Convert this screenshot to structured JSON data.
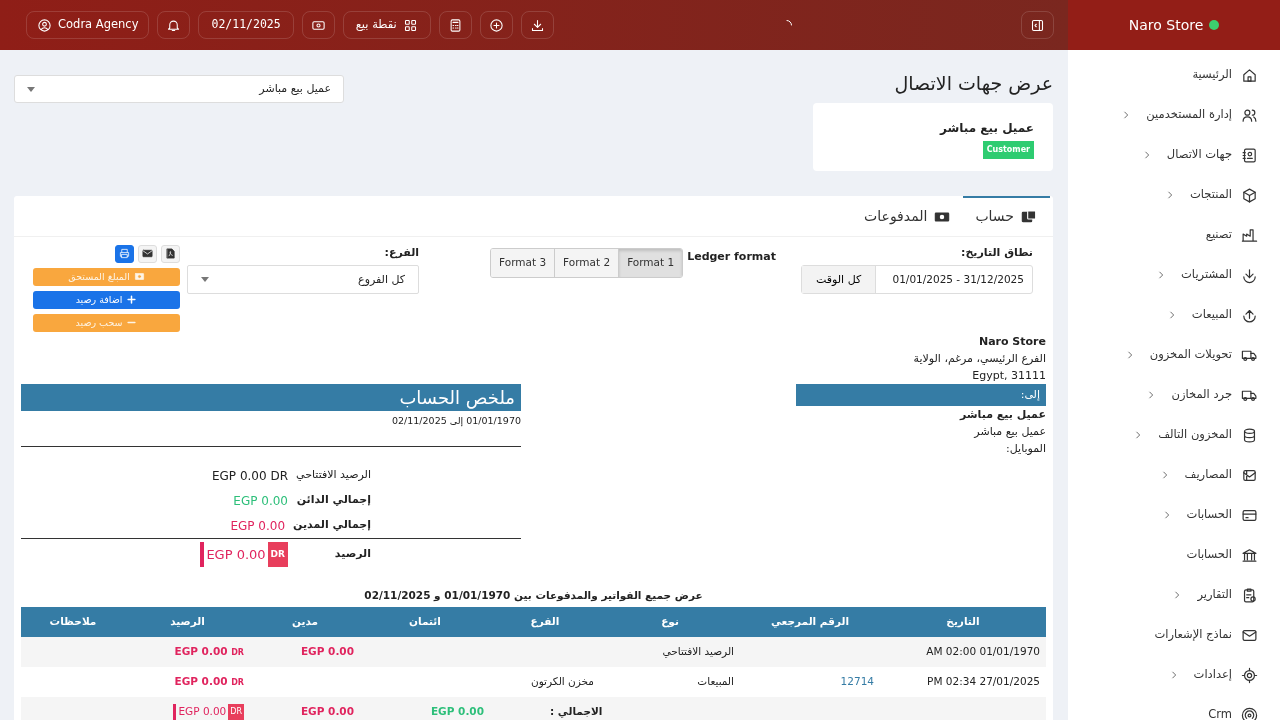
{
  "brand": {
    "name": "Naro Store",
    "online": true
  },
  "topbar": {
    "user": "Codra Agency",
    "date": "02/11/2025",
    "pos_label": "نقطة بيع",
    "loading": true
  },
  "sidebar": {
    "items": [
      {
        "label": "الرئيسية",
        "expandable": false
      },
      {
        "label": "إدارة المستخدمين",
        "expandable": true
      },
      {
        "label": "جهات الاتصال",
        "expandable": true
      },
      {
        "label": "المنتجات",
        "expandable": true
      },
      {
        "label": "تصنيع",
        "expandable": false
      },
      {
        "label": "المشتريات",
        "expandable": true
      },
      {
        "label": "المبيعات",
        "expandable": true
      },
      {
        "label": "تحويلات المخزون",
        "expandable": true
      },
      {
        "label": "جرد المخازن",
        "expandable": true
      },
      {
        "label": "المخزون التالف",
        "expandable": true
      },
      {
        "label": "المصاريف",
        "expandable": true
      },
      {
        "label": "الحسابات",
        "expandable": true
      },
      {
        "label": "الحسابات",
        "expandable": false
      },
      {
        "label": "التقارير",
        "expandable": true
      },
      {
        "label": "نماذج الإشعارات",
        "expandable": false
      },
      {
        "label": "إعدادات",
        "expandable": true
      },
      {
        "label": "Crm",
        "expandable": false
      }
    ]
  },
  "page": {
    "title": "عرض جهات الاتصال",
    "contact_select": "عميل بيع مباشر",
    "contact": {
      "name": "عميل بيع مباشر",
      "badge": "Customer"
    }
  },
  "tabs": [
    {
      "label": "حساب",
      "selected": true
    },
    {
      "label": "المدفوعات",
      "selected": false
    }
  ],
  "filters": {
    "date_label": "نطاق التاريخ:",
    "date_range": "01/01/2025 - 31/12/2025",
    "all_time": "كل الوقت",
    "format_label": "Ledger format",
    "formats": [
      {
        "label": "Format 1",
        "selected": true
      },
      {
        "label": "Format 2",
        "selected": false
      },
      {
        "label": "Format 3",
        "selected": false
      }
    ],
    "branch_label": "الفرع:",
    "branch": "كل الفروع"
  },
  "actions": {
    "icon_buttons": [
      {
        "kind": "print"
      },
      {
        "kind": "email"
      },
      {
        "kind": "pdf"
      }
    ],
    "buttons": [
      {
        "label": "المبلغ المستحق",
        "kind": "due"
      },
      {
        "label": "اضافة رصيد",
        "kind": "add"
      },
      {
        "label": "سحب رصيد",
        "kind": "withdraw"
      }
    ]
  },
  "address": {
    "store": "Naro Store",
    "lines": [
      "الفرع الرئيسي، مرغم، الولاية",
      "Egypt, 31111"
    ],
    "to_label": "إلى:",
    "customer_name": "عميل بيع مباشر",
    "customer_lines": [
      "عميل بيع مباشر",
      "الموبايل:"
    ]
  },
  "summary": {
    "title": "ملخص الحساب",
    "period": "01/01/1970 إلى 02/11/2025",
    "rows": [
      {
        "label": "الرصيد الافتتاحي",
        "value": "EGP 0.00 DR",
        "kind": "plain"
      },
      {
        "label": "إجمالي الدائن",
        "value": "EGP 0.00",
        "kind": "credit"
      },
      {
        "label": "إجمالي المدين",
        "value": "EGP 0.00",
        "kind": "debit"
      },
      {
        "label": "الرصيد",
        "value": "EGP 0.00",
        "suffix": "DR",
        "kind": "balance"
      }
    ]
  },
  "ledger": {
    "caption": "عرض جميع الفواتير والمدفوعات بين 01/01/1970 و 02/11/2025",
    "columns": [
      "التاريخ",
      "الرقم المرجعي",
      "نوع",
      "الفرع",
      "ائتمان",
      "مدين",
      "الرصيد",
      "ملاحظات"
    ],
    "rows": [
      {
        "date": "01/01/1970 02:00 AM",
        "type": "الرصيد الافتتاحي",
        "debit": "EGP 0.00",
        "balance": "EGP 0.00",
        "balance_suffix": "DR"
      },
      {
        "date": "27/01/2025 02:34 PM",
        "ref": "12714",
        "type": "المبيعات",
        "branch": "مخزن الكرتون",
        "balance": "EGP 0.00",
        "balance_suffix": "DR"
      }
    ],
    "total": {
      "label": "الاجمالي :",
      "credit": "EGP 0.00",
      "debit": "EGP 0.00",
      "balance": "EGP 0.00",
      "balance_suffix": "DR"
    }
  }
}
